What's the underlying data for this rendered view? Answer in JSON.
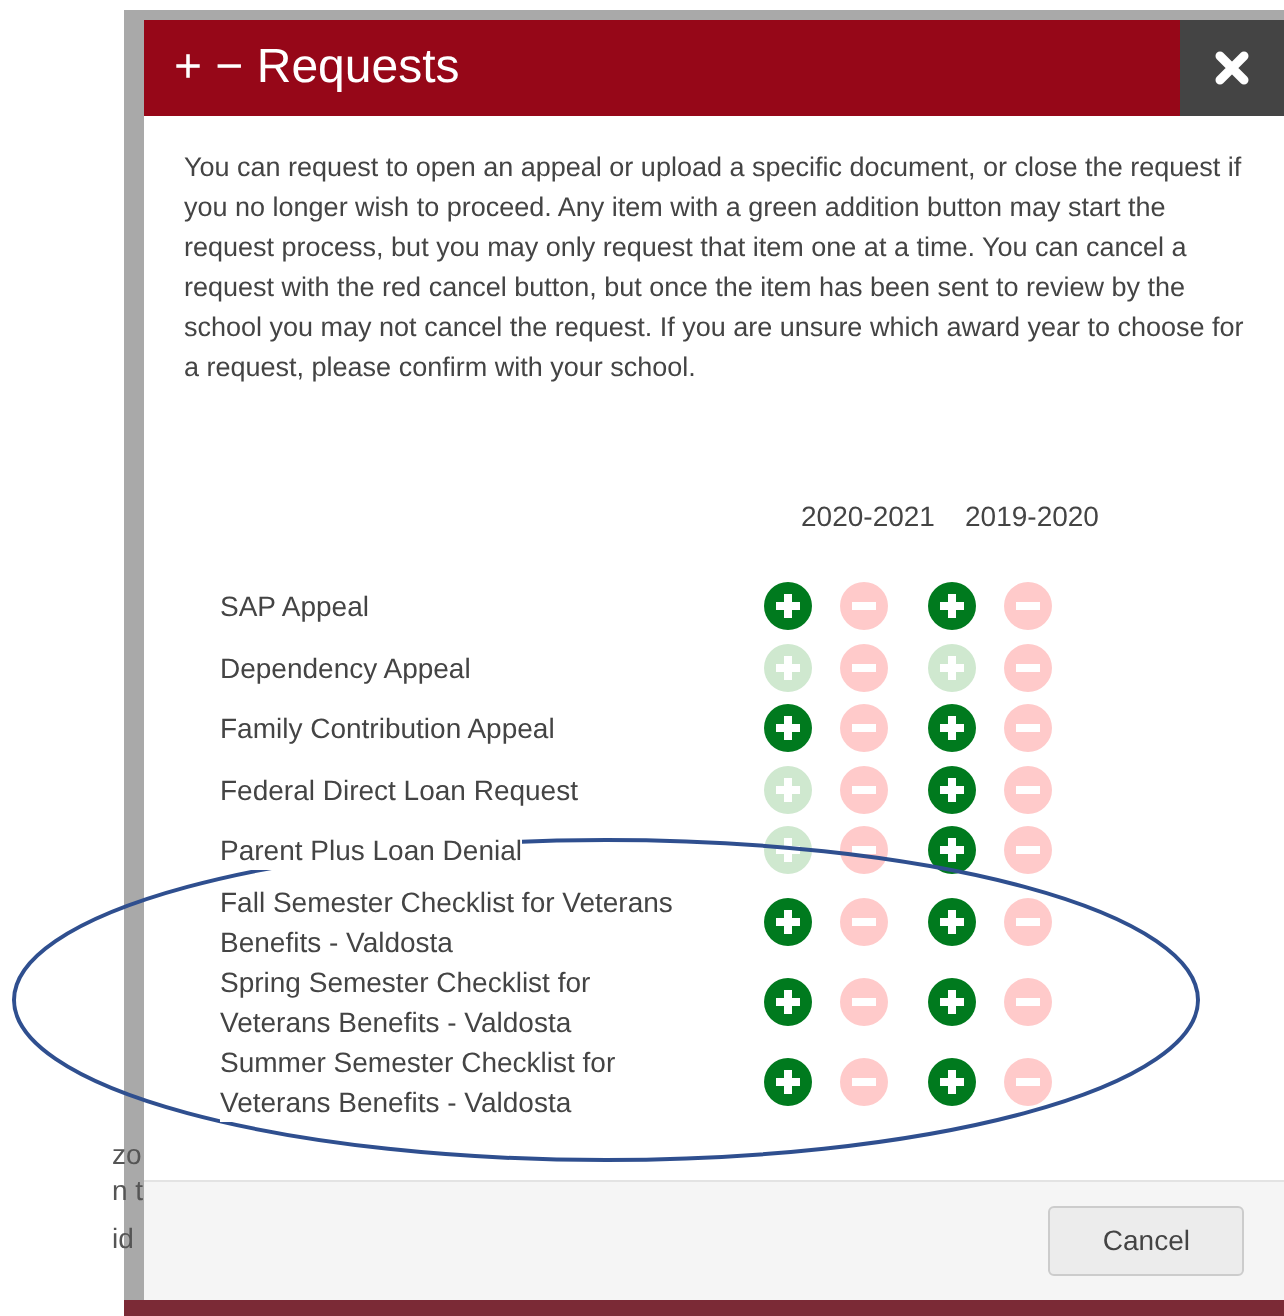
{
  "background_text": [
    "zo",
    "n t",
    "id"
  ],
  "dialog": {
    "title": "+ − Requests",
    "intro": "You can request to open an appeal or upload a specific document, or close the request if you no longer wish to proceed. Any item with a green addition button may start the request process, but you may only request that item one at a time. You can cancel a request with the red cancel button, but once the item has been sent to review by the school you may not cancel the request. If you are unsure which award year to choose for a request, please confirm with your school.",
    "years": [
      "2020-2021",
      "2019-2020"
    ],
    "items": [
      {
        "label": "SAP Appeal",
        "cells": [
          {
            "add_disabled": false,
            "cancel_disabled": true
          },
          {
            "add_disabled": false,
            "cancel_disabled": true
          }
        ]
      },
      {
        "label": "Dependency Appeal",
        "cells": [
          {
            "add_disabled": true,
            "cancel_disabled": true
          },
          {
            "add_disabled": true,
            "cancel_disabled": true
          }
        ]
      },
      {
        "label": "Family Contribution Appeal",
        "cells": [
          {
            "add_disabled": false,
            "cancel_disabled": true
          },
          {
            "add_disabled": false,
            "cancel_disabled": true
          }
        ]
      },
      {
        "label": "Federal Direct Loan Request",
        "cells": [
          {
            "add_disabled": true,
            "cancel_disabled": true
          },
          {
            "add_disabled": false,
            "cancel_disabled": true
          }
        ]
      },
      {
        "label": "Parent Plus Loan Denial",
        "cells": [
          {
            "add_disabled": true,
            "cancel_disabled": true
          },
          {
            "add_disabled": false,
            "cancel_disabled": true
          }
        ]
      },
      {
        "label": "Fall Semester Checklist for Veterans Benefits - Valdosta",
        "cells": [
          {
            "add_disabled": false,
            "cancel_disabled": true
          },
          {
            "add_disabled": false,
            "cancel_disabled": true
          }
        ]
      },
      {
        "label": "Spring Semester Checklist for Veterans Benefits - Valdosta",
        "cells": [
          {
            "add_disabled": false,
            "cancel_disabled": true
          },
          {
            "add_disabled": false,
            "cancel_disabled": true
          }
        ]
      },
      {
        "label": "Summer Semester Checklist for Veterans Benefits - Valdosta",
        "cells": [
          {
            "add_disabled": false,
            "cancel_disabled": true
          },
          {
            "add_disabled": false,
            "cancel_disabled": true
          }
        ]
      }
    ],
    "cancel_button": "Cancel"
  }
}
